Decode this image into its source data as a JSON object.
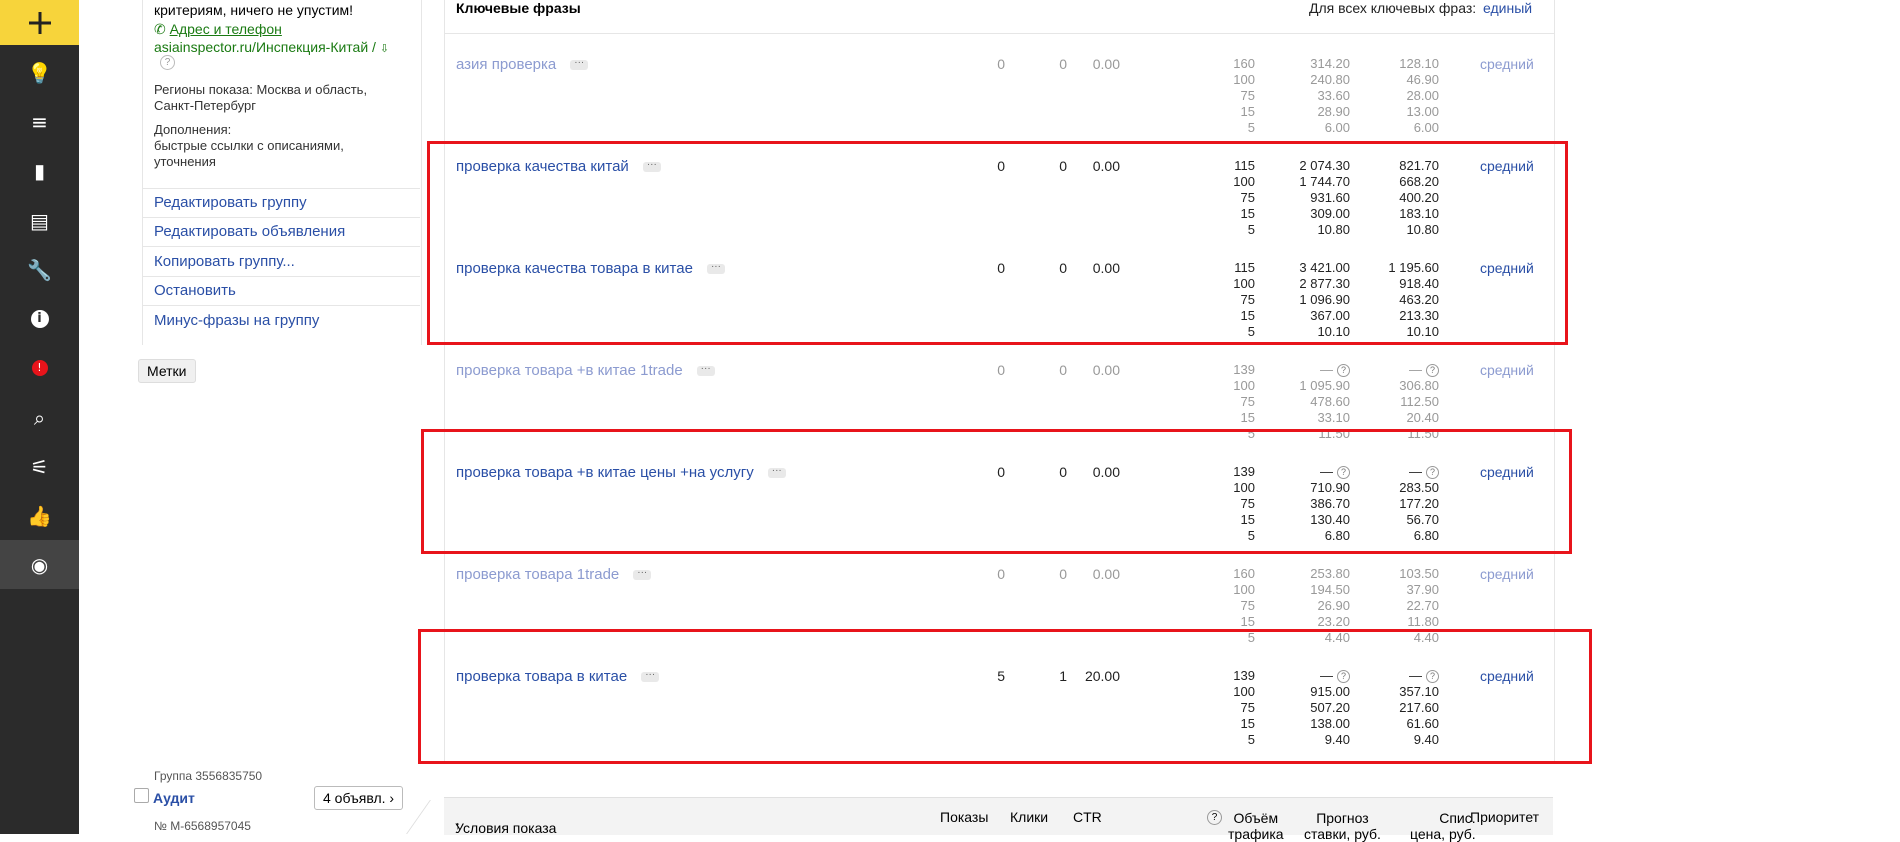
{
  "rail": {
    "items": [
      {
        "name": "bulb-icon",
        "glyph": "💡"
      },
      {
        "name": "list-icon",
        "glyph": "≡"
      },
      {
        "name": "chart-icon",
        "glyph": "▮"
      },
      {
        "name": "stack-icon",
        "glyph": "▤"
      },
      {
        "name": "wrench-icon",
        "glyph": "🔧"
      },
      {
        "name": "info-icon",
        "glyph": "i"
      },
      {
        "name": "rocket-icon",
        "glyph": "!"
      },
      {
        "name": "search-icon",
        "glyph": "⌕"
      },
      {
        "name": "sliders-icon",
        "glyph": "⚟"
      },
      {
        "name": "thumbsup-icon",
        "glyph": "👍"
      },
      {
        "name": "eye-icon",
        "glyph": "◉"
      }
    ]
  },
  "ad_preview": {
    "text_tail": "критериям, ничего не упустим!",
    "contacts_link": "Адрес и телефон",
    "display_url": "asiainspector.ru/Инспекция-Китай /",
    "regions": "Регионы показа: Москва и область, Санкт-Петербург",
    "extras_label": "Дополнения:",
    "extras_value": "быстрые ссылки с описаниями, уточнения"
  },
  "group_actions": [
    "Редактировать группу",
    "Редактировать объявления",
    "Копировать группу...",
    "Остановить",
    "Минус-фразы на группу"
  ],
  "tags_label": "Метки",
  "next_group": {
    "group_id": "Группа 3556835750",
    "name": "Аудит",
    "ads_button": "4 объявл.",
    "number": "№ М-6568957045"
  },
  "table": {
    "header_title": "Ключевые фразы",
    "header_all_label": "Для всех ключевых фраз:",
    "header_all_value": "единый",
    "rows": [
      {
        "phrase": "азия проверка",
        "dim": true,
        "shows": "0",
        "clicks": "0",
        "ctr": "0.00",
        "positions": [
          "160",
          "100",
          "75",
          "15",
          "5"
        ],
        "bids": [
          "314.20",
          "240.80",
          "33.60",
          "28.90",
          "6.00"
        ],
        "charges": [
          "128.10",
          "46.90",
          "28.00",
          "13.00",
          "6.00"
        ],
        "priority": "средний"
      },
      {
        "phrase": "проверка качества китай",
        "dim": false,
        "shows": "0",
        "clicks": "0",
        "ctr": "0.00",
        "positions": [
          "115",
          "100",
          "75",
          "15",
          "5"
        ],
        "bids": [
          "2 074.30",
          "1 744.70",
          "931.60",
          "309.00",
          "10.80"
        ],
        "charges": [
          "821.70",
          "668.20",
          "400.20",
          "183.10",
          "10.80"
        ],
        "priority": "средний"
      },
      {
        "phrase": "проверка качества товара в китае",
        "dim": false,
        "shows": "0",
        "clicks": "0",
        "ctr": "0.00",
        "positions": [
          "115",
          "100",
          "75",
          "15",
          "5"
        ],
        "bids": [
          "3 421.00",
          "2 877.30",
          "1 096.90",
          "367.00",
          "10.10"
        ],
        "charges": [
          "1 195.60",
          "918.40",
          "463.20",
          "213.30",
          "10.10"
        ],
        "priority": "средний"
      },
      {
        "phrase": "проверка товара +в китае 1trade",
        "dim": true,
        "shows": "0",
        "clicks": "0",
        "ctr": "0.00",
        "positions": [
          "139",
          "100",
          "75",
          "15",
          "5"
        ],
        "bids": [
          "—",
          "1 095.90",
          "478.60",
          "33.10",
          "11.50"
        ],
        "charges": [
          "—",
          "306.80",
          "112.50",
          "20.40",
          "11.50"
        ],
        "priority": "средний"
      },
      {
        "phrase": "проверка товара +в китае цены +на услугу",
        "dim": false,
        "shows": "0",
        "clicks": "0",
        "ctr": "0.00",
        "positions": [
          "139",
          "100",
          "75",
          "15",
          "5"
        ],
        "bids": [
          "—",
          "710.90",
          "386.70",
          "130.40",
          "6.80"
        ],
        "charges": [
          "—",
          "283.50",
          "177.20",
          "56.70",
          "6.80"
        ],
        "priority": "средний"
      },
      {
        "phrase": "проверка товара 1trade",
        "dim": true,
        "shows": "0",
        "clicks": "0",
        "ctr": "0.00",
        "positions": [
          "160",
          "100",
          "75",
          "15",
          "5"
        ],
        "bids": [
          "253.80",
          "194.50",
          "26.90",
          "23.20",
          "4.40"
        ],
        "charges": [
          "103.50",
          "37.90",
          "22.70",
          "11.80",
          "4.40"
        ],
        "priority": "средний"
      },
      {
        "phrase": "проверка товара в китае",
        "dim": false,
        "shows": "5",
        "clicks": "1",
        "ctr": "20.00",
        "positions": [
          "139",
          "100",
          "75",
          "15",
          "5"
        ],
        "bids": [
          "—",
          "915.00",
          "507.20",
          "138.00",
          "9.40"
        ],
        "charges": [
          "—",
          "357.10",
          "217.60",
          "61.60",
          "9.40"
        ],
        "priority": "средний"
      }
    ]
  },
  "bottom_header": {
    "conditions": "Условия показа",
    "shows": "Показы",
    "clicks": "Клики",
    "ctr": "CTR",
    "volume": "Объём",
    "volume2": "трафика",
    "forecast": "Прогноз",
    "forecast2": "ставки, руб.",
    "charge": "Спис.",
    "charge2": "цена, руб.",
    "priority": "Приоритет"
  },
  "colors": {
    "accent_yellow": "#f7d43b",
    "rail": "#2b2b2b",
    "link": "#2a4fa6",
    "highlight": "#e8141b"
  }
}
